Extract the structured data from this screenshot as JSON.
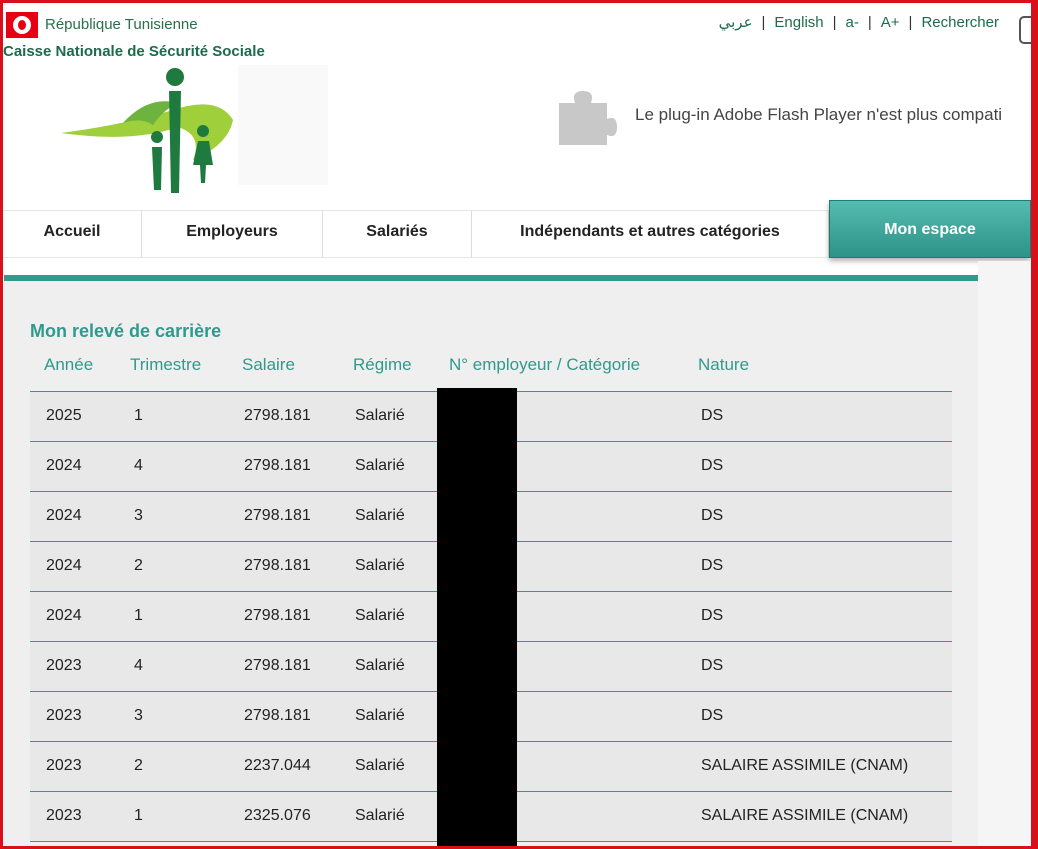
{
  "header": {
    "republic": "République Tunisienne",
    "org_name": "Caisse Nationale de Sécurité Sociale",
    "lang_arabic": "عربي",
    "lang_english": "English",
    "font_decrease": "a-",
    "font_increase": "A+",
    "search_label": "Rechercher",
    "plugin_message": "Le plug-in Adobe Flash Player n'est plus compati",
    "logo_icon": "cnss-logo-icon",
    "plugin_icon": "puzzle-piece-icon",
    "flag_icon": "tunisia-flag-icon"
  },
  "nav": {
    "items": [
      {
        "label": "Accueil"
      },
      {
        "label": "Employeurs"
      },
      {
        "label": "Salariés"
      },
      {
        "label": "Indépendants et autres catégories"
      },
      {
        "label": "Mon espace"
      }
    ],
    "active_index": 4
  },
  "main": {
    "title": "Mon relevé de carrière",
    "columns": [
      "Année",
      "Trimestre",
      "Salaire",
      "Régime",
      "N° employeur / Catégorie",
      "Nature"
    ],
    "rows": [
      {
        "annee": "2025",
        "trimestre": "1",
        "salaire": "2798.181",
        "regime": "Salarié",
        "nature": "DS"
      },
      {
        "annee": "2024",
        "trimestre": "4",
        "salaire": "2798.181",
        "regime": "Salarié",
        "nature": "DS"
      },
      {
        "annee": "2024",
        "trimestre": "3",
        "salaire": "2798.181",
        "regime": "Salarié",
        "nature": "DS"
      },
      {
        "annee": "2024",
        "trimestre": "2",
        "salaire": "2798.181",
        "regime": "Salarié",
        "nature": "DS"
      },
      {
        "annee": "2024",
        "trimestre": "1",
        "salaire": "2798.181",
        "regime": "Salarié",
        "nature": "DS"
      },
      {
        "annee": "2023",
        "trimestre": "4",
        "salaire": "2798.181",
        "regime": "Salarié",
        "nature": "DS"
      },
      {
        "annee": "2023",
        "trimestre": "3",
        "salaire": "2798.181",
        "regime": "Salarié",
        "nature": "DS"
      },
      {
        "annee": "2023",
        "trimestre": "2",
        "salaire": "2237.044",
        "regime": "Salarié",
        "nature": "SALAIRE ASSIMILE (CNAM)"
      },
      {
        "annee": "2023",
        "trimestre": "1",
        "salaire": "2325.076",
        "regime": "Salarié",
        "nature": "SALAIRE ASSIMILE (CNAM)"
      }
    ]
  },
  "colors": {
    "accent": "#2f9a8d",
    "frame_border": "#d8101a",
    "header_green": "#1d6b4a"
  }
}
